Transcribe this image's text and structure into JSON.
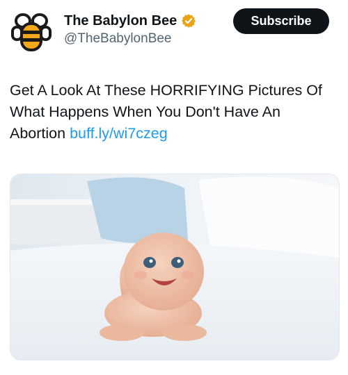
{
  "author": {
    "display_name": "The Babylon Bee",
    "handle": "@TheBabylonBee",
    "avatar_icon": "bee-logo-icon",
    "verified_icon": "verified-badge-icon",
    "verified_color": "#e8a417"
  },
  "actions": {
    "subscribe_label": "Subscribe"
  },
  "tweet": {
    "text": "Get A Look At These HORRIFYING Pictures Of What Happens When You Don't Have An Abortion",
    "link": "buff.ly/wi7czeg",
    "link_color": "#1d9bf0"
  },
  "media": {
    "description_icon": "baby-photo"
  },
  "colors": {
    "text": "#0f1419",
    "secondary": "#536471",
    "button_bg": "#0f1419",
    "button_text": "#ffffff"
  }
}
